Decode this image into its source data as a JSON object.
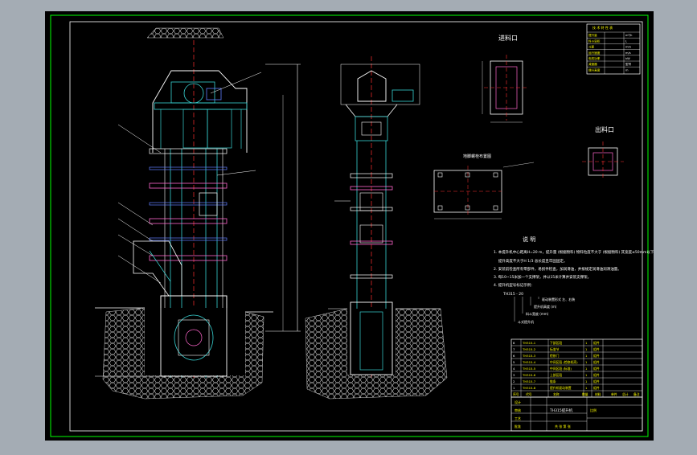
{
  "colors": {
    "backdrop": "#a4acb4",
    "paper": "#000000",
    "frame": "#00ff00",
    "structure": "#ffffff",
    "casing": "#38d3d3",
    "centerline": "#ff3030",
    "accent_pink": "#ff66cc",
    "accent_blue": "#5f7cff",
    "dimension": "#00cc66",
    "yellow": "#ffff00",
    "ground": "#c9c9c9"
  },
  "views": {
    "feed_port_title": "进料口",
    "discharge_port_title": "出料口",
    "foundation_title": "地脚螺栓布置图"
  },
  "notes": {
    "heading": "说 明",
    "lines": [
      "1. 本提升机中心距离H=20 m，提升量 (根据物料) 物料粒度不大于 (根据物料) 其宽度≤50mm以下",
      "　 提升高度不大于H 1/3 总长度且牢固固定。",
      "2. 安装前检查所有零部件，易损件检查，加润滑油，并按规定润滑油润滑油量。",
      "3. 每10~15米加一个支撑架，并以15米计算并安装支撑架。",
      "4. 提升机型号标记示例："
    ],
    "model_code": "TH315 - 20",
    "model_callouts": [
      "驱动装置形式 左、右装",
      "提升机高度 (m)",
      "料斗宽度 (mm)",
      "斗式提升机"
    ]
  },
  "part_list": {
    "rows": [
      {
        "no": "8",
        "code": "TH315-1",
        "name": "下部区段",
        "qty": "1",
        "mat": "组件"
      },
      {
        "no": "7",
        "code": "TH315-2",
        "name": "标准节",
        "qty": "1",
        "mat": "组件"
      },
      {
        "no": "6",
        "code": "TH315-3",
        "name": "检修门",
        "qty": "1",
        "mat": "组件"
      },
      {
        "no": "5",
        "code": "TH315-4",
        "name": "中间区段 (检修机壳)",
        "qty": "1",
        "mat": "组件"
      },
      {
        "no": "4",
        "code": "TH315-5",
        "name": "中间区段 (标准)",
        "qty": "1",
        "mat": "组件"
      },
      {
        "no": "3",
        "code": "TH315-6",
        "name": "上部区段",
        "qty": "1",
        "mat": "组件"
      },
      {
        "no": "2",
        "code": "TH315-7",
        "name": "链条",
        "qty": "1",
        "mat": "组件"
      },
      {
        "no": "1",
        "code": "TH315-8",
        "name": "提升机驱动装置",
        "qty": "1",
        "mat": "组件"
      }
    ],
    "header": [
      "序号",
      "代号",
      "名称",
      "数量",
      "材料",
      "单件",
      "总计",
      "备注"
    ]
  },
  "title_block": {
    "drawing_name": "TH315提升机",
    "scale_label": "比例",
    "sheet_label": "共 张 第 张",
    "row_labels": [
      "设计",
      "审核",
      "工艺",
      "批准"
    ]
  },
  "spec_table": {
    "title": "技 术 特 性 表",
    "rows": [
      [
        "提升量",
        "m³/h"
      ],
      [
        "料斗容积",
        "L"
      ],
      [
        "斗距",
        "mm"
      ],
      [
        "运行速度",
        "m/s"
      ],
      [
        "电机功率",
        "kW"
      ],
      [
        "减速器",
        "型号"
      ],
      [
        "提升高度",
        "m"
      ]
    ]
  }
}
